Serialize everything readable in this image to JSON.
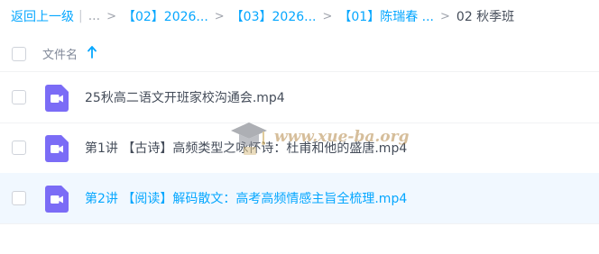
{
  "breadcrumb": {
    "back_label": "返回上一级",
    "pipe": "|",
    "ellipsis": "...",
    "separator": ">",
    "items": [
      {
        "label": "【02】2026..."
      },
      {
        "label": "【03】2026..."
      },
      {
        "label": "【01】陈瑞春 ..."
      }
    ],
    "current": "02 秋季班"
  },
  "header": {
    "name_label": "文件名",
    "sort_icon": "arrow-up-icon"
  },
  "files": [
    {
      "name": "25秋高二语文开班家校沟通会.mp4",
      "icon": "video-file-icon",
      "selected": false
    },
    {
      "name": "第1讲 【古诗】高频类型之咏怀诗：杜甫和他的盛唐.mp4",
      "icon": "video-file-icon",
      "selected": false
    },
    {
      "name": "第2讲 【阅读】解码散文：高考高频情感主旨全梳理.mp4",
      "icon": "video-file-icon",
      "selected": true
    }
  ],
  "watermark": {
    "text": "www.xue-ba.org"
  },
  "colors": {
    "accent": "#06a7ff",
    "file_icon": "#7b6cf6",
    "selected_row": "#f1f8ff"
  }
}
